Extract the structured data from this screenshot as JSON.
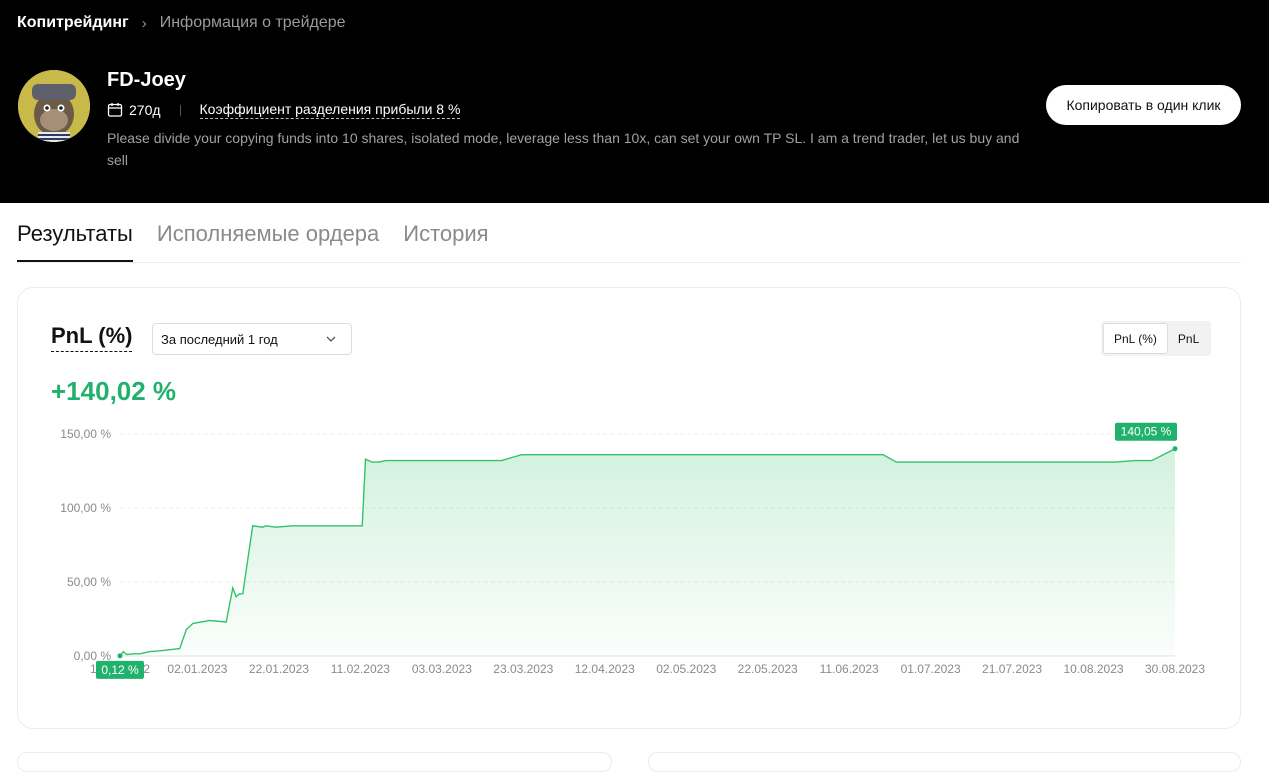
{
  "breadcrumb": {
    "root": "Копитрейдинг",
    "current": "Информация о трейдере"
  },
  "trader": {
    "name": "FD-Joey",
    "days": "270д",
    "profit_share": "Коэффициент разделения прибыли 8 %",
    "description": "Please divide your copying funds into 10 shares, isolated mode, leverage less than 10x, can set your own TP SL. I am a trend trader, let us buy and sell",
    "copy_button": "Копировать в один клик"
  },
  "tabs": [
    {
      "label": "Результаты",
      "active": true
    },
    {
      "label": "Исполняемые ордера",
      "active": false
    },
    {
      "label": "История",
      "active": false
    }
  ],
  "panel": {
    "title": "PnL (%)",
    "period": "За последний 1 год",
    "toggle": [
      "PnL (%)",
      "PnL"
    ],
    "value": "+140,02 %"
  },
  "colors": {
    "accent": "#20b26c",
    "line": "#33c26b"
  },
  "chart_data": {
    "type": "area",
    "y_ticks": [
      "0,00 %",
      "50,00 %",
      "100,00 %",
      "150,00 %"
    ],
    "ylim": [
      0,
      150
    ],
    "x_ticks": [
      "13.12.2022",
      "02.01.2023",
      "22.01.2023",
      "11.02.2023",
      "03.03.2023",
      "23.03.2023",
      "12.04.2023",
      "02.05.2023",
      "22.05.2023",
      "11.06.2023",
      "01.07.2023",
      "21.07.2023",
      "10.08.2023",
      "30.08.2023"
    ],
    "x": [
      0,
      1,
      2,
      4,
      6,
      9,
      12,
      18,
      20,
      22,
      27,
      32,
      34,
      35,
      36,
      37,
      40,
      43,
      44,
      47,
      52,
      56,
      62,
      68,
      73,
      74,
      76,
      78,
      80,
      100,
      115,
      121,
      130,
      170,
      200,
      230,
      234,
      260,
      280,
      300,
      306,
      311,
      318
    ],
    "y": [
      0.12,
      3,
      1,
      1.5,
      1.5,
      3,
      3.5,
      5,
      18,
      22,
      24,
      23,
      46,
      40,
      42,
      42,
      88,
      87,
      88,
      87,
      88,
      88,
      88,
      88,
      88,
      133,
      131,
      131,
      132,
      132,
      132,
      136,
      136,
      136,
      136,
      136,
      131,
      131,
      131,
      131,
      132,
      132,
      140.05
    ],
    "start_label": "0,12 %",
    "end_label": "140,05 %",
    "grid": true
  }
}
